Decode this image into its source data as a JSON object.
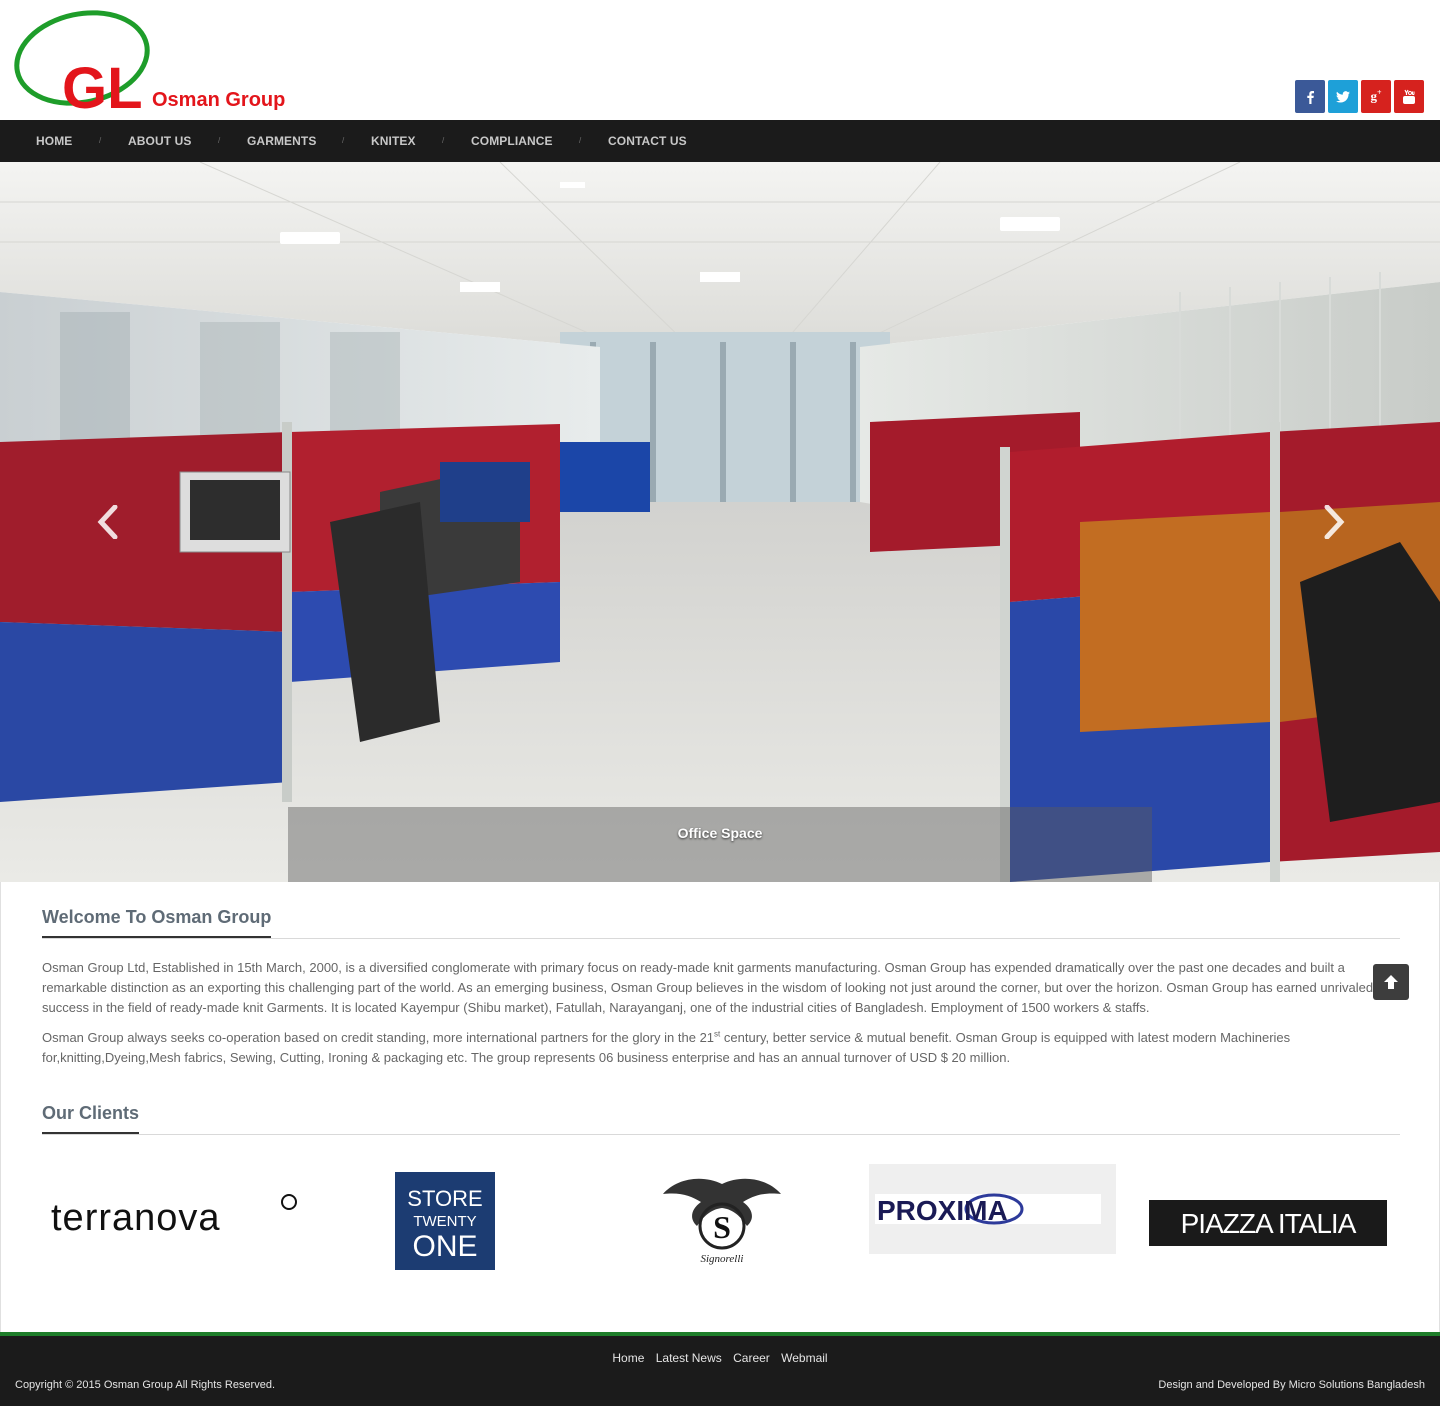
{
  "header": {
    "logo_text": "GL",
    "brand_name": "Osman Group",
    "social": [
      {
        "name": "facebook",
        "glyph": "f"
      },
      {
        "name": "twitter",
        "glyph": "t"
      },
      {
        "name": "google-plus",
        "glyph": "g+"
      },
      {
        "name": "youtube",
        "glyph": "You"
      }
    ]
  },
  "nav": {
    "items": [
      "HOME",
      "ABOUT US",
      "GARMENTS",
      "KNITEX",
      "COMPLIANCE",
      "CONTACT US"
    ],
    "separator": "/"
  },
  "carousel": {
    "caption": "Office Space"
  },
  "welcome": {
    "title": "Welcome To Osman Group",
    "para1": "Osman Group Ltd, Established in 15th March, 2000, is a diversified conglomerate with primary focus on ready-made knit garments manufacturing. Osman Group has expended dramatically over the past one decades and built a remarkable distinction as an exporting this challenging part of the world. As an emerging business, Osman Group believes in the wisdom of looking not just around the corner, but over the horizon. Osman Group has earned unrivaled success in the field of ready-made knit Garments. It is located Kayempur (Shibu market), Fatullah, Narayanganj, one of the industrial cities of Bangladesh. Employment of 1500 workers & staffs.",
    "para2_a": "Osman Group always seeks co-operation based on credit standing, more international partners for the glory in the 21",
    "para2_sup": "st",
    "para2_b": " century, better service & mutual benefit. Osman Group is equipped with latest modern Machineries for,knitting,Dyeing,Mesh fabrics, Sewing, Cutting, Ironing & packaging etc. The group represents 06 business enterprise and has an annual turnover of USD $ 20 million."
  },
  "clients": {
    "title": "Our Clients",
    "logos": [
      "terranova",
      "STORE",
      "TWENTY",
      "ONE",
      "Signorelli",
      "PROXIMA",
      "PIAZZA ITALIA"
    ]
  },
  "footer": {
    "links": [
      "Home",
      "Latest News",
      "Career",
      "Webmail"
    ],
    "copyright": "Copyright © 2015 Osman Group All Rights Reserved.",
    "credit": "Design and Developed By Micro Solutions Bangladesh"
  },
  "colors": {
    "brand_red": "#e3151b",
    "brand_green": "#1e9d2a",
    "nav_bg": "#1b1b1b",
    "footer_accent": "#1e7d2a"
  }
}
